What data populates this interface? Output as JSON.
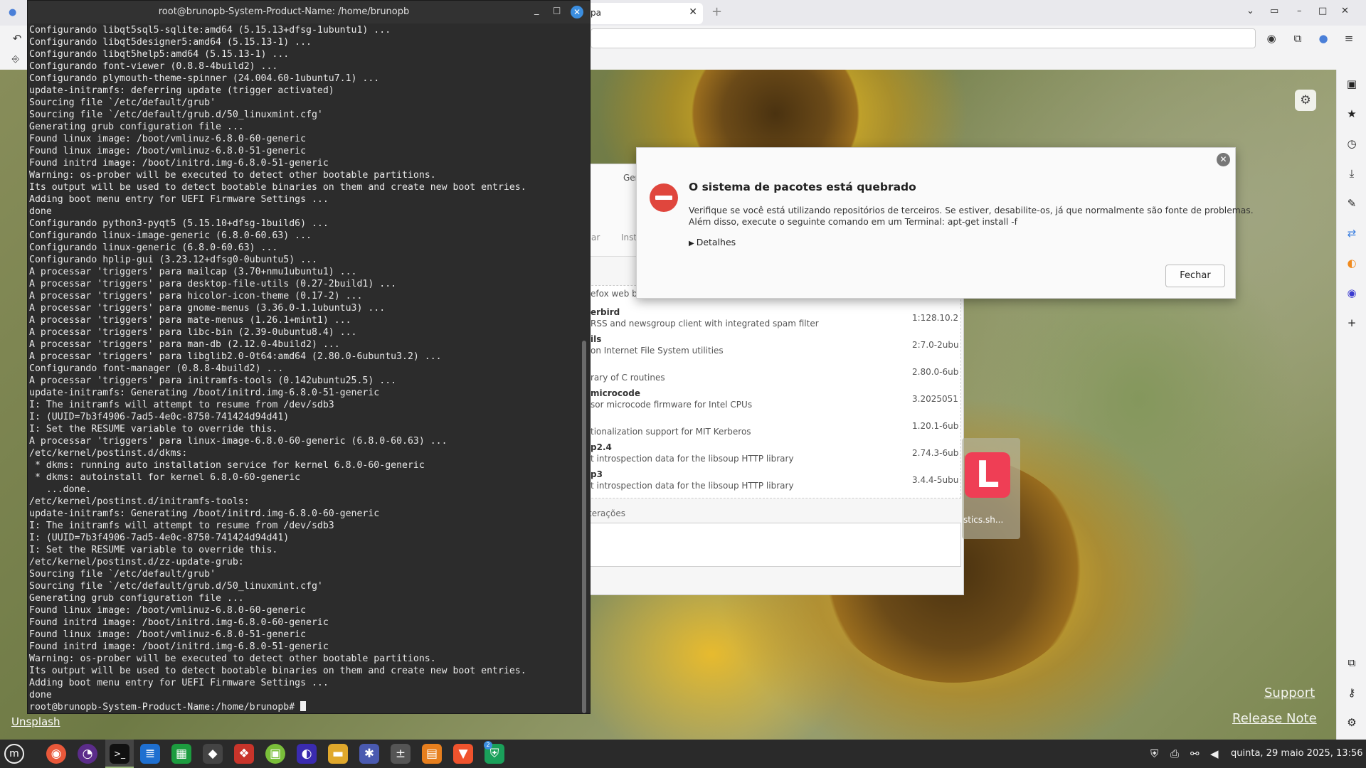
{
  "terminal": {
    "title": "root@brunopb-System-Product-Name: /home/brunopb",
    "lines": [
      "Configurando libqt5sql5-sqlite:amd64 (5.15.13+dfsg-1ubuntu1) ...",
      "Configurando libqt5designer5:amd64 (5.15.13-1) ...",
      "Configurando libqt5help5:amd64 (5.15.13-1) ...",
      "Configurando font-viewer (0.8.8-4build2) ...",
      "Configurando plymouth-theme-spinner (24.004.60-1ubuntu7.1) ...",
      "update-initramfs: deferring update (trigger activated)",
      "Sourcing file `/etc/default/grub'",
      "Sourcing file `/etc/default/grub.d/50_linuxmint.cfg'",
      "Generating grub configuration file ...",
      "Found linux image: /boot/vmlinuz-6.8.0-60-generic",
      "Found linux image: /boot/vmlinuz-6.8.0-51-generic",
      "Found initrd image: /boot/initrd.img-6.8.0-51-generic",
      "Warning: os-prober will be executed to detect other bootable partitions.",
      "Its output will be used to detect bootable binaries on them and create new boot entries.",
      "Adding boot menu entry for UEFI Firmware Settings ...",
      "done",
      "Configurando python3-pyqt5 (5.15.10+dfsg-1build6) ...",
      "Configurando linux-image-generic (6.8.0-60.63) ...",
      "Configurando linux-generic (6.8.0-60.63) ...",
      "Configurando hplip-gui (3.23.12+dfsg0-0ubuntu5) ...",
      "A processar 'triggers' para mailcap (3.70+nmu1ubuntu1) ...",
      "A processar 'triggers' para desktop-file-utils (0.27-2build1) ...",
      "A processar 'triggers' para hicolor-icon-theme (0.17-2) ...",
      "A processar 'triggers' para gnome-menus (3.36.0-1.1ubuntu3) ...",
      "A processar 'triggers' para mate-menus (1.26.1+mint1) ...",
      "A processar 'triggers' para libc-bin (2.39-0ubuntu8.4) ...",
      "A processar 'triggers' para man-db (2.12.0-4build2) ...",
      "A processar 'triggers' para libglib2.0-0t64:amd64 (2.80.0-6ubuntu3.2) ...",
      "Configurando font-manager (0.8.8-4build2) ...",
      "A processar 'triggers' para initramfs-tools (0.142ubuntu25.5) ...",
      "update-initramfs: Generating /boot/initrd.img-6.8.0-51-generic",
      "I: The initramfs will attempt to resume from /dev/sdb3",
      "I: (UUID=7b3f4906-7ad5-4e0c-8750-741424d94d41)",
      "I: Set the RESUME variable to override this.",
      "A processar 'triggers' para linux-image-6.8.0-60-generic (6.8.0-60.63) ...",
      "/etc/kernel/postinst.d/dkms:",
      " * dkms: running auto installation service for kernel 6.8.0-60-generic",
      " * dkms: autoinstall for kernel 6.8.0-60-generic",
      "   ...done.",
      "/etc/kernel/postinst.d/initramfs-tools:",
      "update-initramfs: Generating /boot/initrd.img-6.8.0-60-generic",
      "I: The initramfs will attempt to resume from /dev/sdb3",
      "I: (UUID=7b3f4906-7ad5-4e0c-8750-741424d94d41)",
      "I: Set the RESUME variable to override this.",
      "/etc/kernel/postinst.d/zz-update-grub:",
      "Sourcing file `/etc/default/grub'",
      "Sourcing file `/etc/default/grub.d/50_linuxmint.cfg'",
      "Generating grub configuration file ...",
      "Found linux image: /boot/vmlinuz-6.8.0-60-generic",
      "Found initrd image: /boot/initrd.img-6.8.0-60-generic",
      "Found linux image: /boot/vmlinuz-6.8.0-51-generic",
      "Found initrd image: /boot/initrd.img-6.8.0-51-generic",
      "Warning: os-prober will be executed to detect other bootable partitions.",
      "Its output will be used to detect bootable binaries on them and create new boot entries.",
      "Adding boot menu entry for UEFI Firmware Settings ...",
      "done"
    ],
    "prompt": "root@brunopb-System-Product-Name:/home/brunopb# "
  },
  "dialog": {
    "title": "O sistema de pacotes está quebrado",
    "message_line1": "Verifique se você está utilizando repositórios de terceiros. Se estiver, desabilite-os, já que normalmente são fonte de problemas.",
    "message_line2": "Além disso, execute o seguinte comando em um Terminal: apt-get install -f",
    "details_label": "Detalhes",
    "close_button": "Fechar"
  },
  "package_manager": {
    "tab_general": "Ger",
    "tab_installed": "Inst",
    "tab_ar": "ar",
    "rows": [
      {
        "name": "",
        "desc": "efox web browser",
        "version": ""
      },
      {
        "name": "erbird",
        "desc": "RSS and newsgroup client with integrated spam filter",
        "version": "1:128.10.2"
      },
      {
        "name": "ils",
        "desc": "on Internet File System utilities",
        "version": "2:7.0-2ubu"
      },
      {
        "name": "",
        "desc": "rary of C routines",
        "version": "2.80.0-6ub"
      },
      {
        "name": "microcode",
        "desc": "sor microcode firmware for Intel CPUs",
        "version": "3.2025051"
      },
      {
        "name": "",
        "desc": "tionalization support for MIT Kerberos",
        "version": "1.20.1-6ub"
      },
      {
        "name": "p2.4",
        "desc": "t introspection data for the libsoup HTTP library",
        "version": "2.74.3-6ub"
      },
      {
        "name": "p3",
        "desc": "t introspection data for the libsoup HTTP library",
        "version": "3.4.4-5ubu"
      }
    ],
    "changes_label": "terações"
  },
  "browser": {
    "tab_title": "pa"
  },
  "desktop": {
    "icon_label": "stics.sh...",
    "icon_letter": "L",
    "unsplash_link": "Unsplash",
    "support_link": "Support",
    "release_link": "Release Note"
  },
  "taskbar": {
    "clock": "quinta, 29 maio 2025, 13:56",
    "badge_count": "2"
  },
  "colors": {
    "dialog_error_icon": "#e0463d",
    "terminal_bg": "#2c2c2c",
    "taskbar_bg": "#2a2a2a",
    "accent_blue": "#3b8ee0",
    "desktop_icon_red": "#ef3e55"
  }
}
